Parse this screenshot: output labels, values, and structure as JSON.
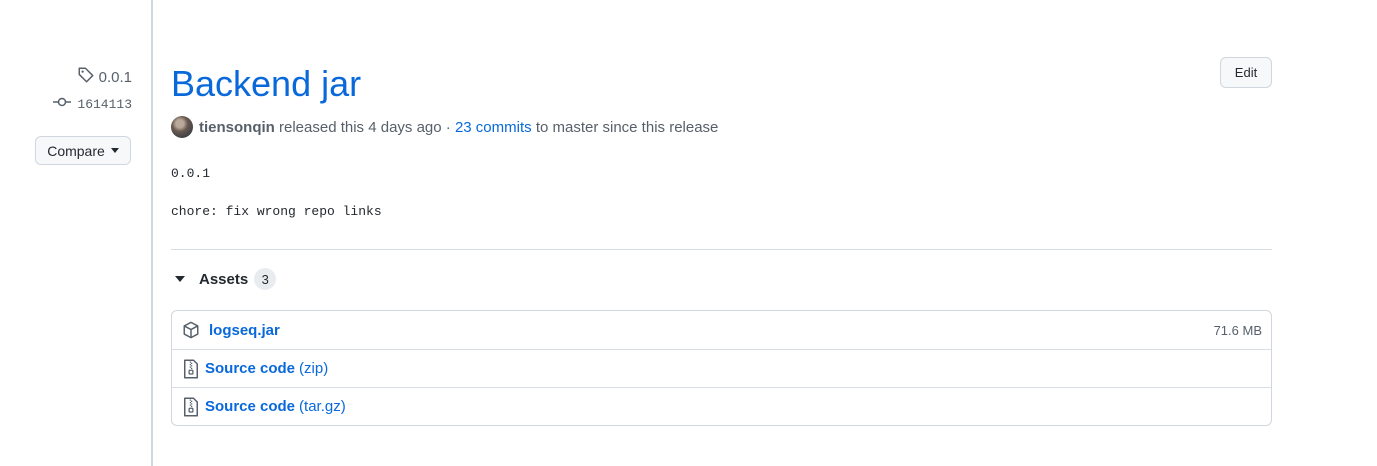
{
  "sidebar": {
    "tag": "0.0.1",
    "commit": "1614113",
    "compare_label": "Compare"
  },
  "release": {
    "title": "Backend jar",
    "edit_label": "Edit",
    "author": "tiensonqin",
    "released_text": "released this 4 days ago",
    "separator": "·",
    "commits_link": "23 commits",
    "commits_suffix": "to master since this release",
    "body_lines": [
      "0.0.1",
      "chore: fix wrong repo links"
    ]
  },
  "assets": {
    "heading": "Assets",
    "count": "3",
    "items": [
      {
        "name": "logseq.jar",
        "suffix": "",
        "size": "71.6 MB",
        "icon": "package-icon"
      },
      {
        "name": "Source code",
        "suffix": "(zip)",
        "size": "",
        "icon": "file-zip-icon"
      },
      {
        "name": "Source code",
        "suffix": "(tar.gz)",
        "size": "",
        "icon": "file-zip-icon"
      }
    ]
  },
  "colors": {
    "link": "#0969da",
    "muted": "#57606a",
    "border": "#d0d7de"
  }
}
